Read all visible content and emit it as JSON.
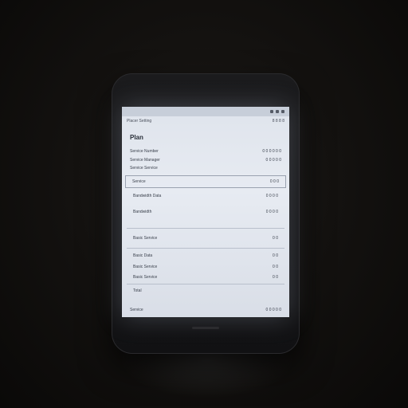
{
  "status_bar": {
    "icons": [
      "signal-icon",
      "wifi-icon",
      "battery-icon"
    ]
  },
  "topbar": {
    "left": "Placer Setting",
    "right": "8 8 8 8"
  },
  "title": "Plan",
  "rows": [
    {
      "label": "Service Number",
      "value": "0 0 0 0 0 0"
    },
    {
      "label": "Service Manager",
      "value": "0 0 0 0 0"
    },
    {
      "label": "Service Service",
      "value": ""
    },
    {
      "label": "Service",
      "value": "0 0 0"
    },
    {
      "label": "Bandwidth Data",
      "value": "0 0 0 0"
    },
    {
      "label": "Bandwidth",
      "value": "0 0 0 0"
    },
    {
      "label": "Basic Service",
      "value": "0 0"
    },
    {
      "label": "Basic Data",
      "value": "0 0"
    },
    {
      "label": "Basic Service",
      "value": "0 0"
    },
    {
      "label": "Basic Service",
      "value": "0 0"
    },
    {
      "label": "Total",
      "value": ""
    }
  ],
  "footer": {
    "left": "Service",
    "right": "0 0 0 0 0"
  }
}
